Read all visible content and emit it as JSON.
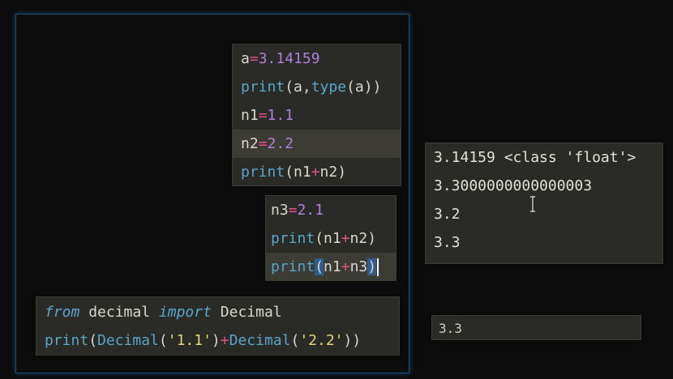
{
  "code_block_1": {
    "l1": {
      "var": "a",
      "eq": "=",
      "num": "3.14159"
    },
    "l2": {
      "fn": "print",
      "p1": "(a,",
      "fn2": "type",
      "p2": "(a))"
    },
    "l3": {
      "var": "n1",
      "eq": "=",
      "num": "1.1"
    },
    "l4": {
      "var": "n2",
      "eq": "=",
      "num": "2.2"
    },
    "l5": {
      "fn": "print",
      "p1": "(n1",
      "op": "+",
      "p2": "n2)"
    }
  },
  "code_block_2": {
    "l1": {
      "var": "n3",
      "eq": "=",
      "num": "2.1"
    },
    "l2": {
      "fn": "print",
      "p1": "(n1",
      "op": "+",
      "p2": "n2)"
    },
    "l3": {
      "fn": "print",
      "open": "(",
      "a": "n1",
      "op": "+",
      "b": "n3",
      "close": ")"
    }
  },
  "code_block_3": {
    "l1": {
      "kw1": "from",
      "mod": " decimal ",
      "kw2": "import",
      "cls": " Decimal"
    },
    "l2": {
      "fn": "print",
      "o1": "(",
      "c1": "Decimal",
      "o2": "(",
      "s1": "'1.1'",
      "c2": ")",
      "op": "+",
      "c3": "Decimal",
      "o3": "(",
      "s2": "'2.2'",
      "c4": "))"
    }
  },
  "output_block": {
    "lines": [
      "3.14159 <class 'float'>",
      "3.3000000000000003",
      "3.2",
      "3.3"
    ]
  },
  "output_small": {
    "text": "3.3"
  }
}
